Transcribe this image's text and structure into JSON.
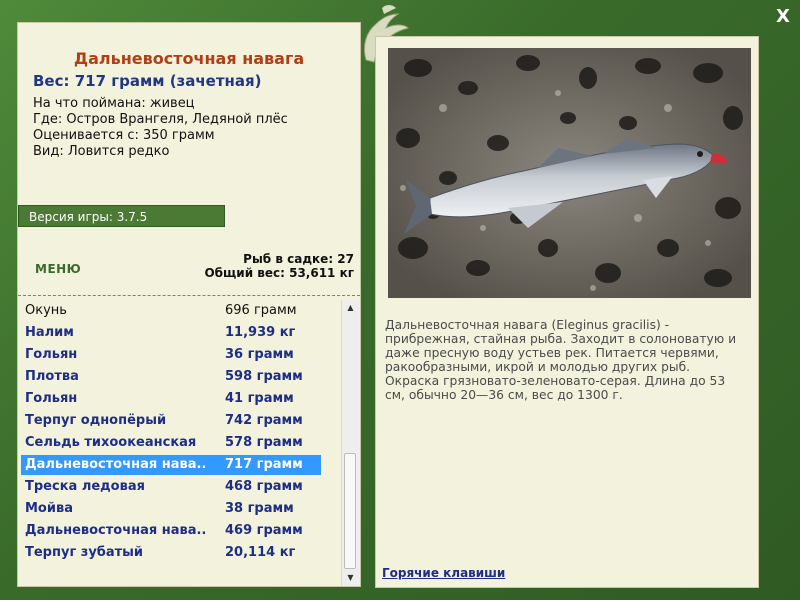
{
  "catch": {
    "title": "Дальневосточная навага",
    "weight": "Вес: 717 грамм (зачетная)",
    "bait": "На что поймана: живец",
    "place": "Где: Остров Врангеля, Ледяной плёс",
    "rated": "Оценивается с: 350 грамм",
    "kind": "Вид: Ловится редко"
  },
  "version": "Версия игры: 3.7.5",
  "menu_label": "МЕНЮ",
  "stats": {
    "count": "Рыб в садке: 27",
    "total": "Общий вес: 53,611 кг"
  },
  "fish_list": [
    {
      "name": "Окунь",
      "weight": "696 грамм"
    },
    {
      "name": "Налим",
      "weight": "11,939 кг"
    },
    {
      "name": "Гольян",
      "weight": "36 грамм"
    },
    {
      "name": "Плотва",
      "weight": "598 грамм"
    },
    {
      "name": "Гольян",
      "weight": "41 грамм"
    },
    {
      "name": "Терпуг однопёрый",
      "weight": "742 грамм"
    },
    {
      "name": "Сельдь тихоокеанская",
      "weight": "578 грамм"
    },
    {
      "name": "Дальневосточная нава...",
      "weight": "717 грамм"
    },
    {
      "name": "Треска ледовая",
      "weight": "468 грамм"
    },
    {
      "name": "Мойва",
      "weight": "38 грамм"
    },
    {
      "name": "Дальневосточная нава...",
      "weight": "469 грамм"
    },
    {
      "name": "Терпуг зубатый",
      "weight": "20,114 кг"
    }
  ],
  "description": "Дальневосточная навага (Eleginus gracilis) - прибрежная, стайная рыба. Заходит в солоноватую и даже пресную воду устьев рек. Питается червями, ракообразными, икрой и молодью других рыб. Окраска грязновато-зеленовато-серая. Длина до 53 см, обычно 20—36 см, вес до 1300 г.",
  "hotkeys_label": "Горячие клавиши",
  "close_label": "X",
  "icons": {
    "close": "close-icon",
    "logo": "fish-logo-icon",
    "scroll_up": "arrow-up-icon",
    "scroll_down": "arrow-down-icon"
  },
  "colors": {
    "frame": "#3b6a2c",
    "panel": "#f3f2dc",
    "title": "#b13f16",
    "link": "#1e2d86",
    "selection": "#3399ff"
  }
}
